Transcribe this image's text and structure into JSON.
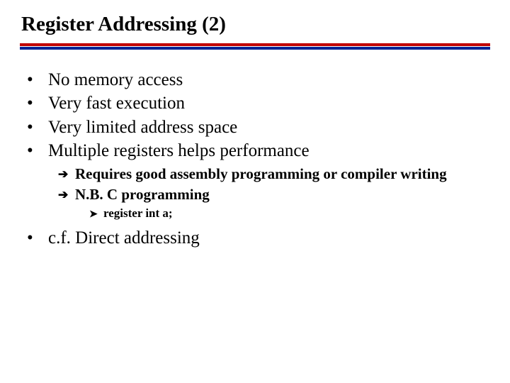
{
  "title": "Register Addressing (2)",
  "bullets": {
    "b1": "No memory access",
    "b2": "Very fast execution",
    "b3": "Very limited address space",
    "b4": "Multiple registers helps performance",
    "b5": "c.f. Direct addressing"
  },
  "sub": {
    "s1": "Requires good assembly programming or compiler writing",
    "s2": "N.B. C programming"
  },
  "subsub": {
    "ss1": "register int a;"
  },
  "icons": {
    "dot": "•",
    "arrow_ne": "➔",
    "arrow_small": "➤"
  }
}
